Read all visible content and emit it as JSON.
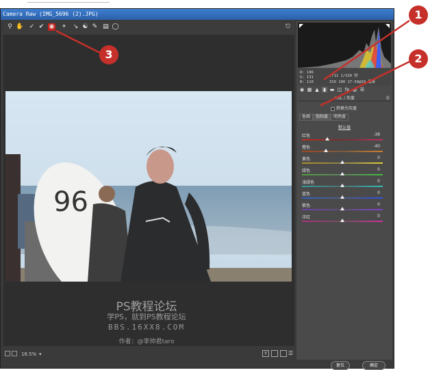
{
  "window": {
    "title": "Camera Raw (IMG_5696 (2).JPG)"
  },
  "toolbar": {
    "tools": [
      "zoom-icon",
      "hand-icon",
      "white-balance-icon",
      "color-sampler-icon",
      "targeted-adjustment-icon",
      "crop-icon",
      "straighten-icon",
      "spot-removal-icon",
      "brush-icon",
      "gradient-icon",
      "radial-icon"
    ],
    "selected": "targeted-adjustment-icon"
  },
  "info": {
    "r": "R: 196",
    "g": "G: 131",
    "b": "B: 110",
    "exposure": "f/11  1/320 秒",
    "iso": "ISO 100  17-50@50 毫米"
  },
  "hsl": {
    "header": "HSL / 灰度",
    "grayscale_label": "转换为灰度",
    "tabs": [
      "色相",
      "饱和度",
      "明亮度"
    ],
    "active_tab": "饱和度",
    "group_label": "默认值",
    "sliders": [
      {
        "label": "红色",
        "value": "-38",
        "pos": 0.31,
        "colors": [
          "#c03020",
          "#703030",
          "#c03060"
        ]
      },
      {
        "label": "橙色",
        "value": "-40",
        "pos": 0.3,
        "colors": [
          "#a04a20",
          "#7a5a40",
          "#d08030"
        ]
      },
      {
        "label": "黄色",
        "value": "0",
        "pos": 0.5,
        "colors": [
          "#b09020",
          "#8a8050",
          "#e0d030"
        ]
      },
      {
        "label": "绿色",
        "value": "0",
        "pos": 0.5,
        "colors": [
          "#50a040",
          "#608060",
          "#40c040"
        ]
      },
      {
        "label": "浅绿色",
        "value": "0",
        "pos": 0.5,
        "colors": [
          "#30a0a0",
          "#507070",
          "#30c0c0"
        ]
      },
      {
        "label": "蓝色",
        "value": "0",
        "pos": 0.5,
        "colors": [
          "#3060c0",
          "#505a80",
          "#3050e0"
        ]
      },
      {
        "label": "紫色",
        "value": "0",
        "pos": 0.5,
        "colors": [
          "#7040b0",
          "#605070",
          "#8040d0"
        ]
      },
      {
        "label": "洋红",
        "value": "0",
        "pos": 0.5,
        "colors": [
          "#b03080",
          "#705060",
          "#d030a0"
        ]
      }
    ]
  },
  "watermark": {
    "line1": "PS教程论坛",
    "line2": "学PS，就到PS教程论坛",
    "line3": "BBS.16XX8.COM",
    "line4": "作者：@李帅君taro"
  },
  "bottombar": {
    "zoom": "16.5%"
  },
  "buttons": {
    "reset": "复位",
    "ok": "确定"
  },
  "annotations": [
    {
      "num": "1"
    },
    {
      "num": "2"
    },
    {
      "num": "3"
    }
  ],
  "colors": {
    "accent": "#c6302a",
    "panel": "#4a4a4a",
    "titlebar": "#2b5fa8"
  }
}
